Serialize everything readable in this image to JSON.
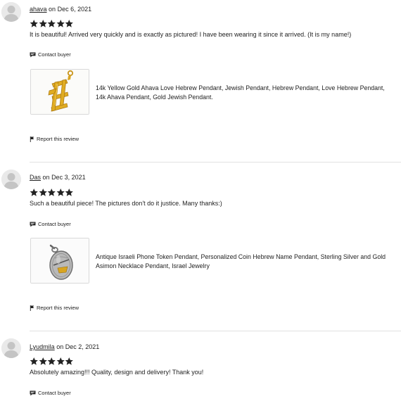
{
  "reviews": [
    {
      "user": "ahava",
      "date_prefix": "on",
      "date": "Dec 6, 2021",
      "rating": 5,
      "text": "It is beautiful! Arrived very quickly and is exactly as pictured! I have been wearing it since it arrived. (It is my name!)",
      "contact_label": "Contact buyer",
      "product_title": "14k Yellow Gold Ahava Love Hebrew Pendant, Jewish Pendant, Hebrew Pendant, Love Hebrew Pendant, 14k Ahava Pendant, Gold Jewish Pendant.",
      "report_label": "Report this review"
    },
    {
      "user": "Das",
      "date_prefix": "on",
      "date": "Dec 3, 2021",
      "rating": 5,
      "text": "Such a beautiful piece! The pictures don't do it justice. Many thanks:)",
      "contact_label": "Contact buyer",
      "product_title": "Antique Israeli Phone Token Pendant, Personalized Coin Hebrew Name Pendant, Sterling Silver and Gold Asimon Necklace Pendant, Israel Jewelry",
      "report_label": "Report this review"
    },
    {
      "user": "Lyudmila",
      "date_prefix": "on",
      "date": "Dec 2, 2021",
      "rating": 5,
      "text": "Absolutely amazing!!! Quality, design and delivery! Thank you!",
      "contact_label": "Contact buyer"
    }
  ],
  "colors": {
    "text": "#222222",
    "star": "#222222",
    "divider": "#e1e1e1",
    "avatar_bg": "#e9e9e9",
    "avatar_fg": "#c4c4c4",
    "gold": "#d4a017"
  }
}
